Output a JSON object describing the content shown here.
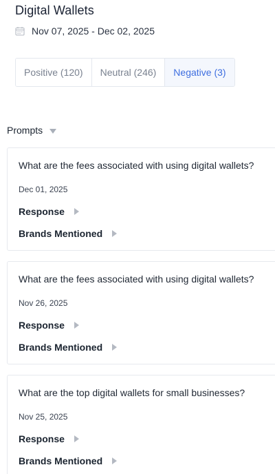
{
  "header": {
    "title": "Digital Wallets",
    "date_range": "Nov 07, 2025 - Dec 02, 2025",
    "icon": "calendar-icon"
  },
  "tabs": [
    {
      "label": "Positive (120)",
      "active": false
    },
    {
      "label": "Neutral (246)",
      "active": false
    },
    {
      "label": "Negative (3)",
      "active": true
    }
  ],
  "prompts": {
    "label": "Prompts",
    "icon": "caret-down-icon",
    "items": [
      {
        "question": "What are the fees associated with using digital wallets?",
        "date": "Dec 01, 2025",
        "response_label": "Response",
        "brands_label": "Brands Mentioned"
      },
      {
        "question": "What are the fees associated with using digital wallets?",
        "date": "Nov 26, 2025",
        "response_label": "Response",
        "brands_label": "Brands Mentioned"
      },
      {
        "question": "What are the top digital wallets for small businesses?",
        "date": "Nov 25, 2025",
        "response_label": "Response",
        "brands_label": "Brands Mentioned"
      }
    ]
  },
  "colors": {
    "accent": "#3e6ee0",
    "active_tab_bg": "#f4f7fd",
    "border": "#e3e7ee",
    "muted_text": "#7a8290"
  }
}
